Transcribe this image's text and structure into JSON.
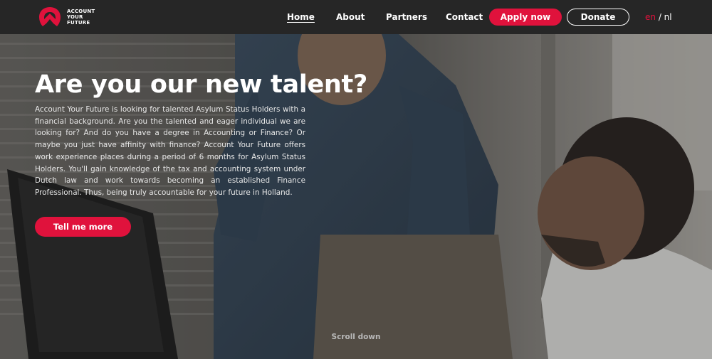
{
  "brand": {
    "logo_lines": [
      "ACCOUNT",
      "YOUR",
      "FUTURE"
    ],
    "accent_color": "#e0123c"
  },
  "nav": {
    "items": [
      {
        "label": "Home",
        "active": true
      },
      {
        "label": "About",
        "active": false
      },
      {
        "label": "Partners",
        "active": false
      },
      {
        "label": "Contact",
        "active": false
      }
    ],
    "apply_label": "Apply now",
    "donate_label": "Donate",
    "lang_en": "en",
    "lang_sep": " / ",
    "lang_nl": "nl"
  },
  "hero": {
    "title": "Are you our new talent?",
    "body": "Account Your Future is looking for talented Asylum Status Holders with a financial background. Are you the talented and eager individual we are looking for? And do you have a degree in Accounting or Finance? Or maybe you just have affinity with finance? Account Your Future offers work experience places during a period of 6 months for Asylum Status Holders. You'll gain knowledge of the tax and accounting system under Dutch law and work towards becoming an established Finance Professional. Thus, being truly accountable for your future in Holland.",
    "cta_label": "Tell me more",
    "scroll_label": "Scroll down"
  }
}
